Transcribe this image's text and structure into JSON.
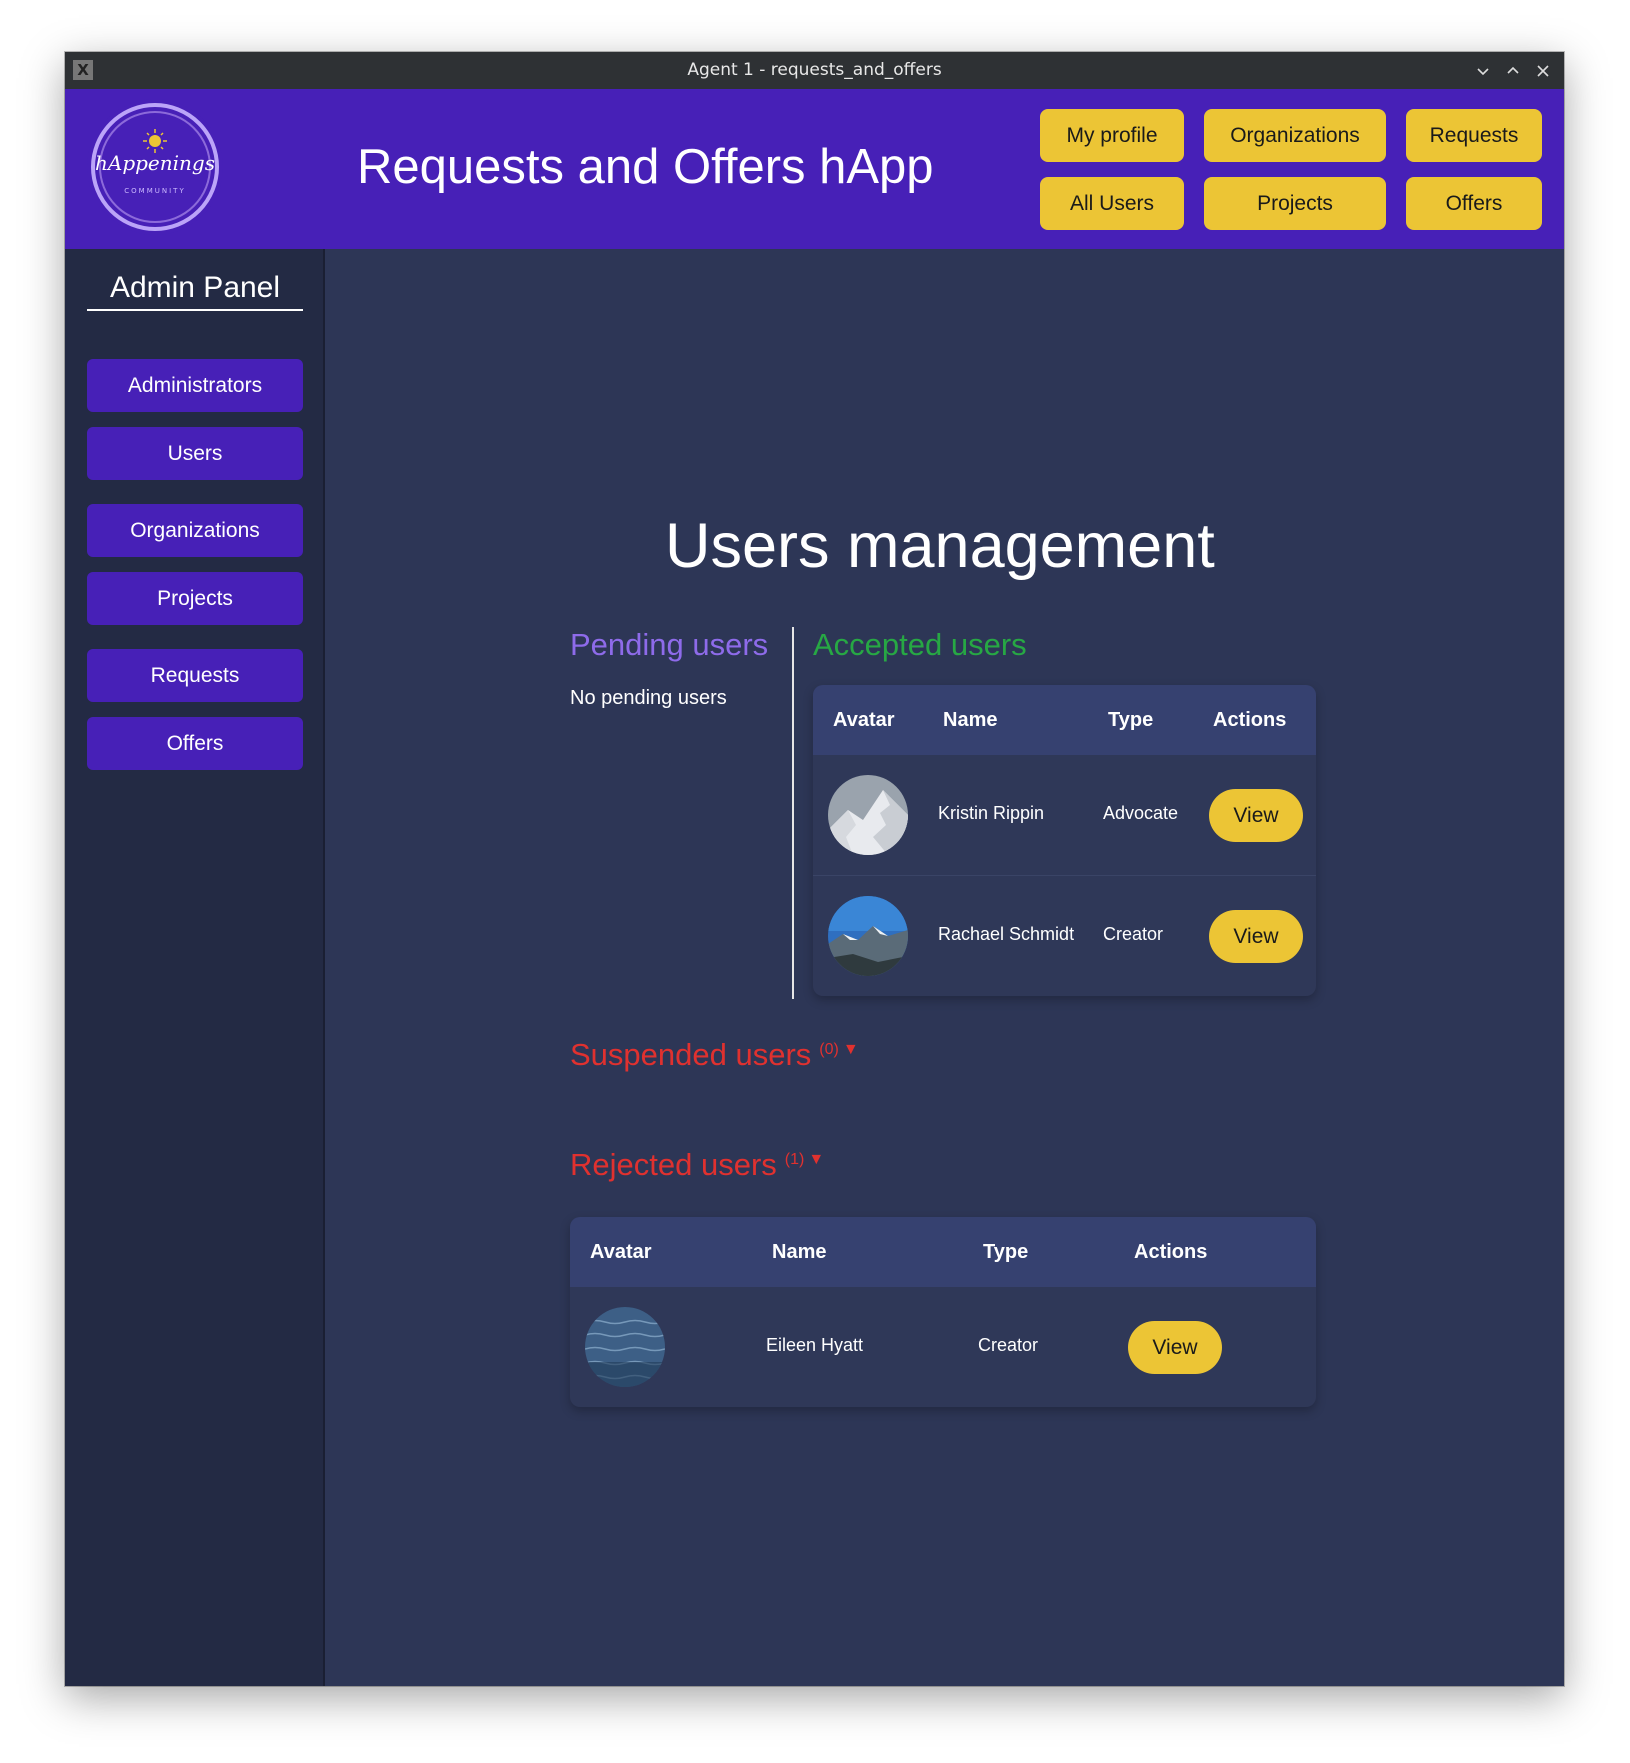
{
  "window": {
    "title": "Agent 1 - requests_and_offers"
  },
  "header": {
    "logo_text": "hAppenings",
    "logo_subtext": "COMMUNITY",
    "app_title": "Requests and Offers hApp",
    "nav": {
      "my_profile": "My profile",
      "organizations": "Organizations",
      "requests": "Requests",
      "all_users": "All Users",
      "projects": "Projects",
      "offers": "Offers"
    }
  },
  "sidebar": {
    "title": "Admin Panel",
    "items": [
      "Administrators",
      "Users",
      "Organizations",
      "Projects",
      "Requests",
      "Offers"
    ]
  },
  "main": {
    "title": "Users management",
    "pending": {
      "title": "Pending users",
      "empty_text": "No pending users"
    },
    "accepted": {
      "title": "Accepted users",
      "columns": [
        "Avatar",
        "Name",
        "Type",
        "Actions"
      ],
      "rows": [
        {
          "avatar": "mountain-snow-avatar",
          "name": "Kristin Rippin",
          "type": "Advocate",
          "action": "View"
        },
        {
          "avatar": "mountain-sky-avatar",
          "name": "Rachael Schmidt",
          "type": "Creator",
          "action": "View"
        }
      ]
    },
    "suspended": {
      "title": "Suspended users",
      "count": "(0)"
    },
    "rejected": {
      "title": "Rejected users",
      "count": "(1)",
      "columns": [
        "Avatar",
        "Name",
        "Type",
        "Actions"
      ],
      "rows": [
        {
          "avatar": "ocean-avatar",
          "name": "Eileen Hyatt",
          "type": "Creator",
          "action": "View"
        }
      ]
    }
  },
  "colors": {
    "header_bg": "#4720b7",
    "nav_button": "#ecc535",
    "page_bg": "#2d3656",
    "sidebar_bg": "#232a44",
    "pending_title": "#8e6bea",
    "accepted_title": "#27a844",
    "rejected_title": "#e0312f"
  }
}
